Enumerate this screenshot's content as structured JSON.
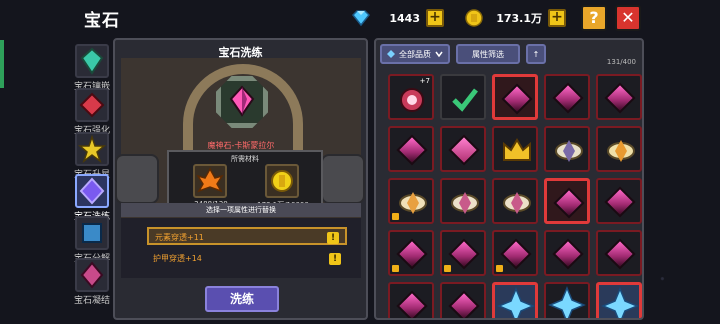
{
  "header": {
    "title": "宝石",
    "diamonds": "1443",
    "gold": "173.1万",
    "help_label": "?",
    "close_label": "✕"
  },
  "tabs": [
    {
      "label": "宝石镶嵌",
      "icon": "gem-inlay-icon"
    },
    {
      "label": "宝石强化",
      "icon": "gem-enhance-icon"
    },
    {
      "label": "宝石升星",
      "icon": "gem-star-icon"
    },
    {
      "label": "宝石洗练",
      "icon": "gem-refine-icon",
      "active": true
    },
    {
      "label": "宝石分解",
      "icon": "gem-decompose-icon"
    },
    {
      "label": "宝石凝结",
      "icon": "gem-condense-icon"
    }
  ],
  "refine": {
    "title": "宝石洗练",
    "selected_gem": "魔神石-卡斯蒙拉尔",
    "materials_title": "所需材料",
    "material1_count": "2488/120",
    "material2_count": "173.1万/10000",
    "hint": "选择一项属性进行替换",
    "attributes": [
      {
        "label": "元素穿透+11",
        "selected": true
      },
      {
        "label": "护甲穿透+14",
        "selected": false
      }
    ],
    "warn_symbol": "!",
    "wash_label": "洗练"
  },
  "inventory": {
    "quality_filter": "全部品质",
    "attr_filter": "属性筛选",
    "sort_label": "↑",
    "count": "131/400",
    "plus_badge": "+7"
  },
  "colors": {
    "accent_red": "#e03a3a",
    "gold": "#f0c518",
    "purple_button": "#5a4fb0"
  }
}
